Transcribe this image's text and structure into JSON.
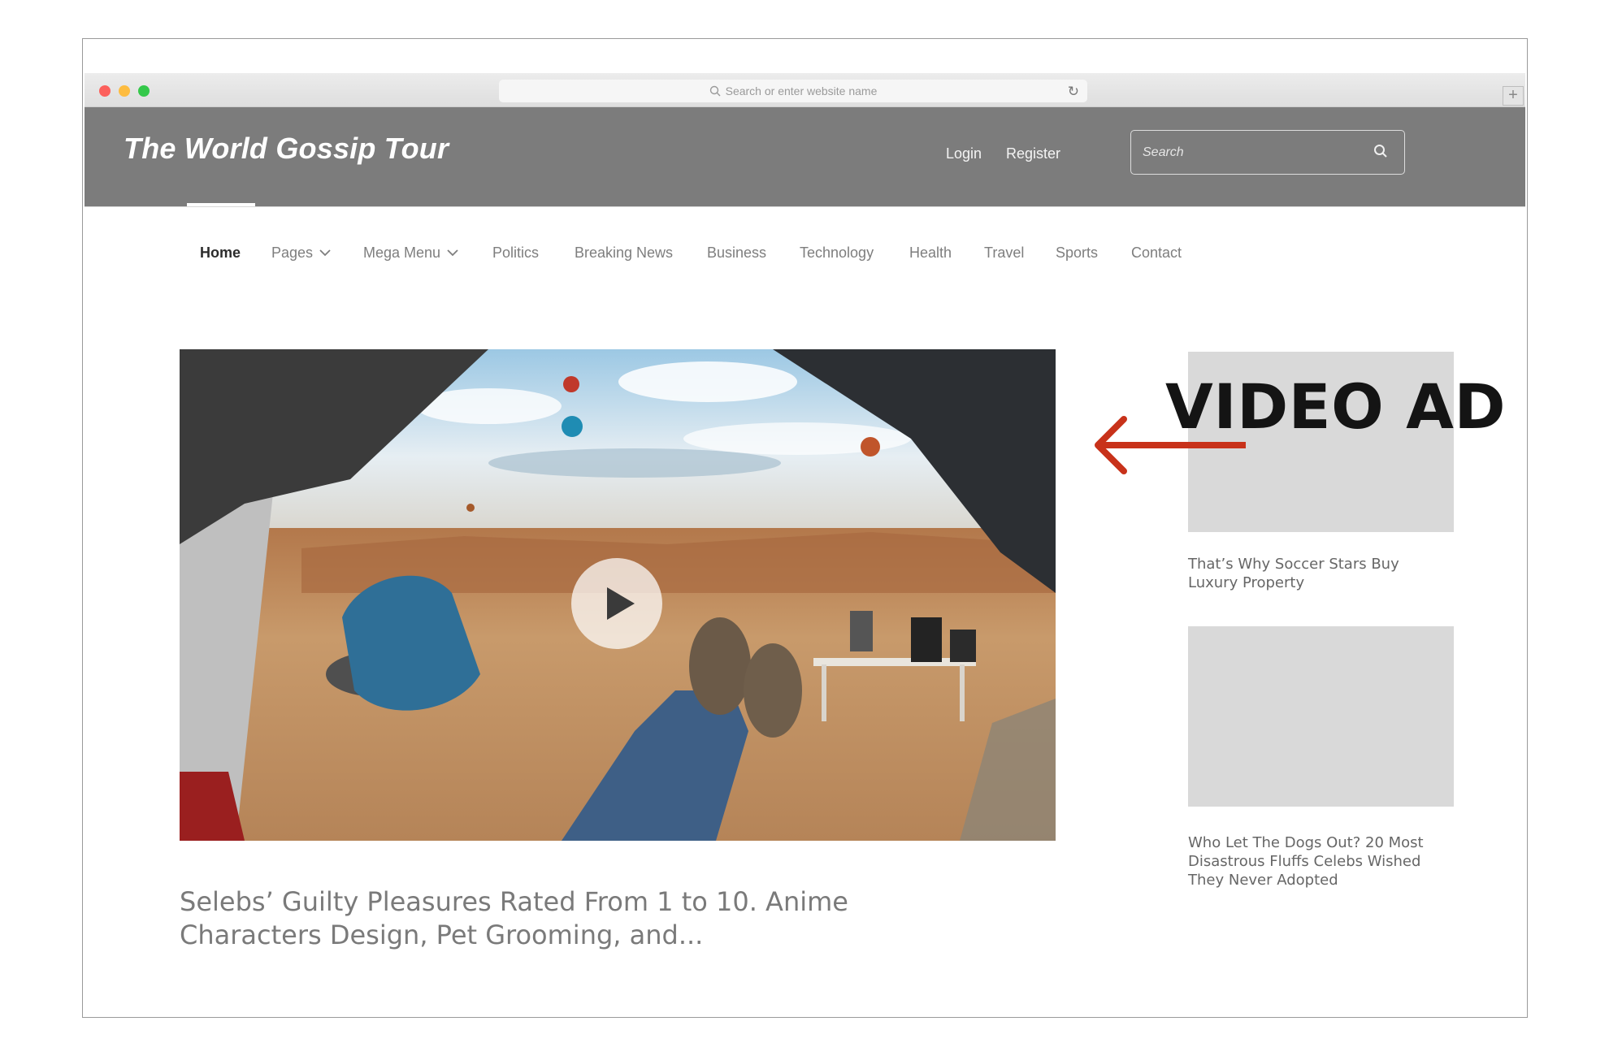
{
  "browser": {
    "url_placeholder": "Search or enter website name",
    "new_tab": "+"
  },
  "header": {
    "site_title": "The World Gossip Tour",
    "login": "Login",
    "register": "Register",
    "search_placeholder": "Search"
  },
  "nav": {
    "items": [
      {
        "label": "Home",
        "active": true
      },
      {
        "label": "Pages",
        "dropdown": true
      },
      {
        "label": "Mega Menu",
        "dropdown": true
      },
      {
        "label": "Politics"
      },
      {
        "label": "Breaking News"
      },
      {
        "label": "Business"
      },
      {
        "label": "Technology"
      },
      {
        "label": "Health"
      },
      {
        "label": "Travel"
      },
      {
        "label": "Sports"
      },
      {
        "label": "Contact"
      }
    ]
  },
  "main": {
    "video_play_icon": "play-icon",
    "headline": "Selebs’ Guilty Pleasures Rated From 1 to 10. Anime Characters Design, Pet Grooming, and..."
  },
  "sidebar": {
    "ad_label": "VIDEO AD",
    "articles": [
      {
        "title": "That’s Why Soccer Stars Buy Luxury Property"
      },
      {
        "title": "Who Let The Dogs Out? 20 Most Disastrous Fluffs Celebs Wished They Never Adopted"
      }
    ]
  },
  "colors": {
    "header_bg": "#7c7c7c",
    "placeholder_gray": "#d9d9d9",
    "arrow_red": "#c8321a"
  }
}
